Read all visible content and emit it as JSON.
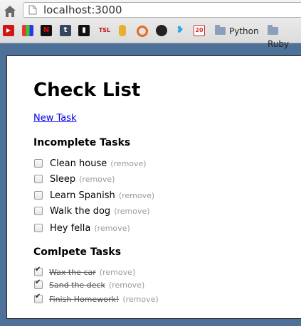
{
  "browser": {
    "url": "localhost:3000",
    "bookmarks": [
      {
        "icon": "youtube-icon",
        "color": "#d01616",
        "glyph": "▶"
      },
      {
        "icon": "tv-icon",
        "color": "#3a3a6a",
        "glyph": "▦"
      },
      {
        "icon": "netflix-icon",
        "color": "#b81d24",
        "glyph": "N"
      },
      {
        "icon": "tumblr-icon",
        "color": "#35465c",
        "glyph": "t"
      },
      {
        "icon": "book-icon",
        "color": "#111111",
        "glyph": "▮"
      },
      {
        "icon": "tsl-icon",
        "color": "#ffffff",
        "glyph": "TSL"
      },
      {
        "icon": "bottle-icon",
        "color": "#e0a020",
        "glyph": "●"
      },
      {
        "icon": "ring-icon",
        "color": "#e56b1f",
        "glyph": "◉"
      },
      {
        "icon": "github-icon",
        "color": "#222222",
        "glyph": "●"
      },
      {
        "icon": "twitter-icon",
        "color": "#2aa9e0",
        "glyph": "🐦"
      },
      {
        "icon": "calendar-icon",
        "color": "#d33",
        "glyph": "20"
      }
    ],
    "folders": [
      "Python",
      "Ruby"
    ]
  },
  "page": {
    "title": "Check List",
    "new_task_link": "New Task",
    "incomplete_heading": "Incomplete Tasks",
    "complete_heading": "Comlpete Tasks",
    "remove_label": "(remove)",
    "incomplete_tasks": [
      "Clean house",
      "Sleep",
      "Learn Spanish",
      "Walk the dog",
      "Hey fella"
    ],
    "complete_tasks": [
      "Wax the car",
      "Sand the deck",
      "Finish Homework!"
    ]
  }
}
